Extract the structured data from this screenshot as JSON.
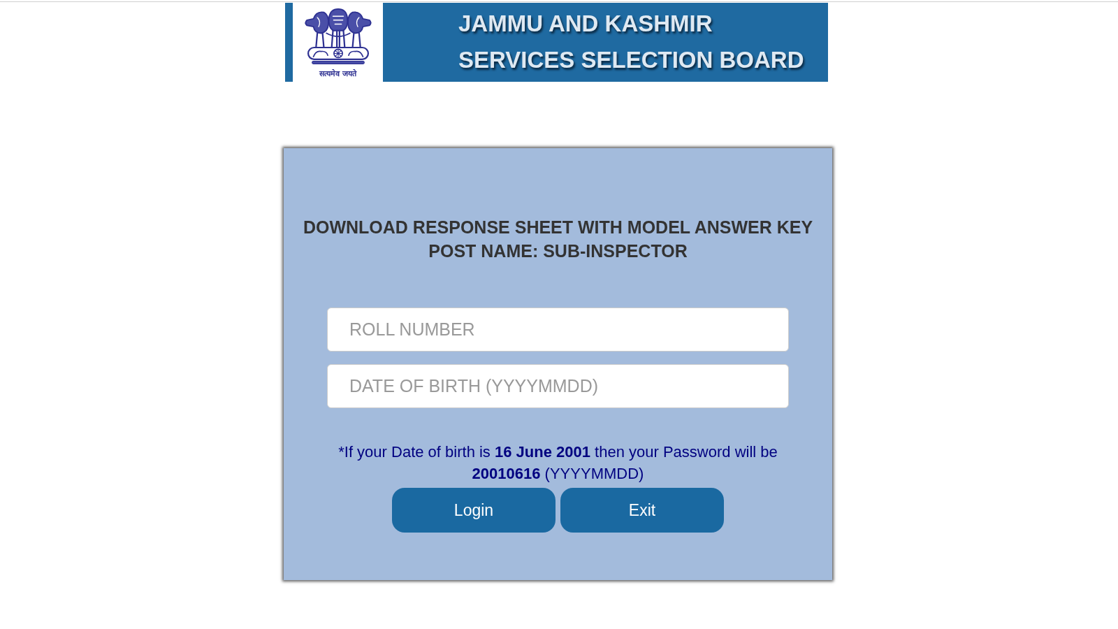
{
  "banner": {
    "emblem_motto": "सत्यमेव जयते",
    "title_lines": [
      "JAMMU AND KASHMIR",
      "SERVICES SELECTION BOARD"
    ]
  },
  "login_card": {
    "heading_lines": [
      "DOWNLOAD RESPONSE SHEET WITH MODEL ANSWER KEY",
      "POST NAME: SUB-INSPECTOR"
    ],
    "fields": [
      {
        "placeholder": "ROLL NUMBER"
      },
      {
        "placeholder": "DATE OF BIRTH (YYYYMMDD)"
      }
    ],
    "note": "*If your Date of birth is **16 June 2001** then your Password will be **20010616** (YYYYMMDD)",
    "buttons": [
      "Login",
      "Exit"
    ]
  }
}
